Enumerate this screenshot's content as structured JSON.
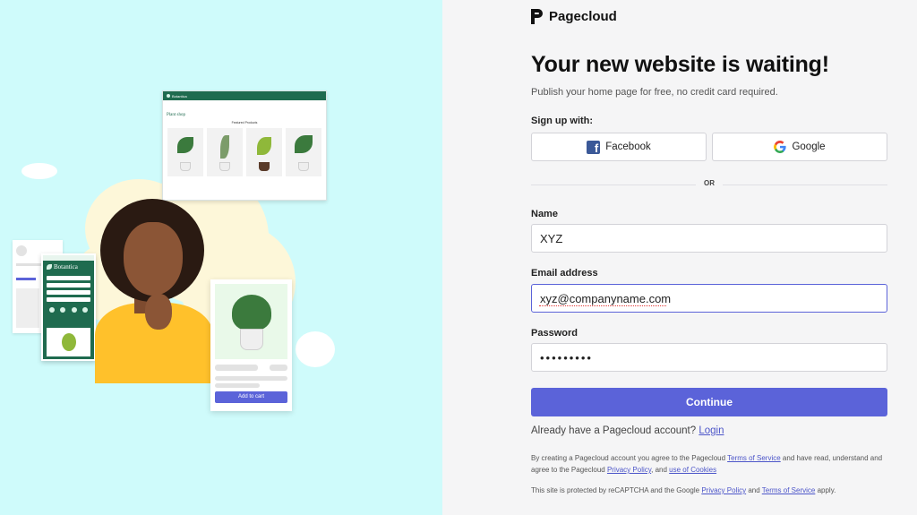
{
  "illustration": {
    "desktop_brand": "Botantica",
    "desktop_title": "Plant shop",
    "desktop_section": "Featured Products",
    "mobile_brand": "Botantica",
    "product_button": "Add to cart"
  },
  "brand": {
    "name": "Pagecloud"
  },
  "heading": "Your new website is waiting!",
  "subheading": "Publish your home page for free, no credit card required.",
  "signup_with": "Sign up with:",
  "oauth": {
    "facebook": "Facebook",
    "google": "Google"
  },
  "divider_text": "OR",
  "form": {
    "name_label": "Name",
    "name_value": "XYZ",
    "email_label": "Email address",
    "email_value": "xyz@companyname.com",
    "password_label": "Password",
    "password_value": "•••••••••",
    "submit": "Continue"
  },
  "login": {
    "prompt": "Already have a Pagecloud account?",
    "link": "Login"
  },
  "legal": {
    "p1_a": "By creating a Pagecloud account you agree to the Pagecloud ",
    "terms": "Terms of Service",
    "p1_b": " and have read, understand and agree to the Pagecloud ",
    "privacy": "Privacy Policy",
    "p1_c": ", and ",
    "cookies": "use of Cookies",
    "p2_a": "This site is protected by reCAPTCHA and the Google ",
    "g_privacy": "Privacy Policy",
    "p2_b": " and ",
    "g_terms": "Terms of Service",
    "p2_c": " apply."
  },
  "colors": {
    "accent": "#5b63d9",
    "left_bg": "#cffbfb",
    "right_bg": "#f5f5f6"
  }
}
